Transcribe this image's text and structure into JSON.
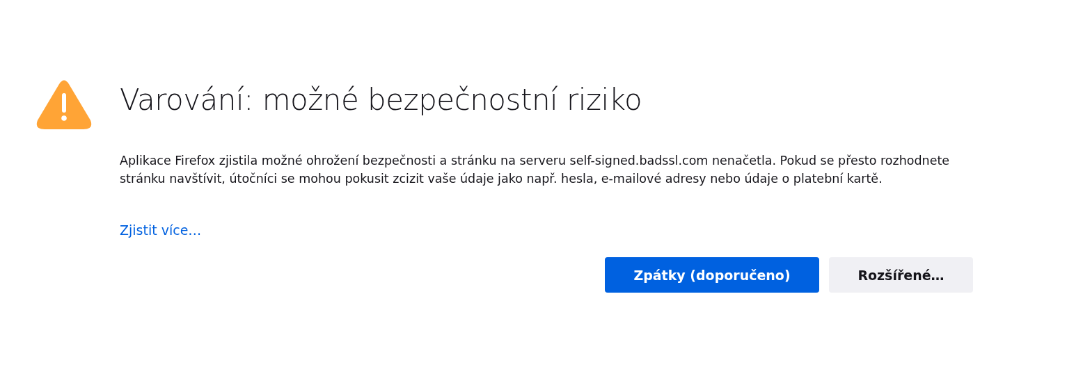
{
  "title": "Varování: možné bezpečnostní riziko",
  "description": "Aplikace Firefox zjistila možné ohrožení bezpečnosti a stránku na serveru self-signed.badssl.com nenačetla. Pokud se přesto rozhodnete stránku navštívit, útočníci se mohou pokusit zcizit vaše údaje jako např. hesla, e-mailové adresy nebo údaje o platební kartě.",
  "learn_more_link": "Zjistit více…",
  "buttons": [
    {
      "label": "Zpátky (doporučeno)",
      "kind": "primary"
    },
    {
      "label": "Rozšířené…",
      "kind": "secondary"
    }
  ]
}
